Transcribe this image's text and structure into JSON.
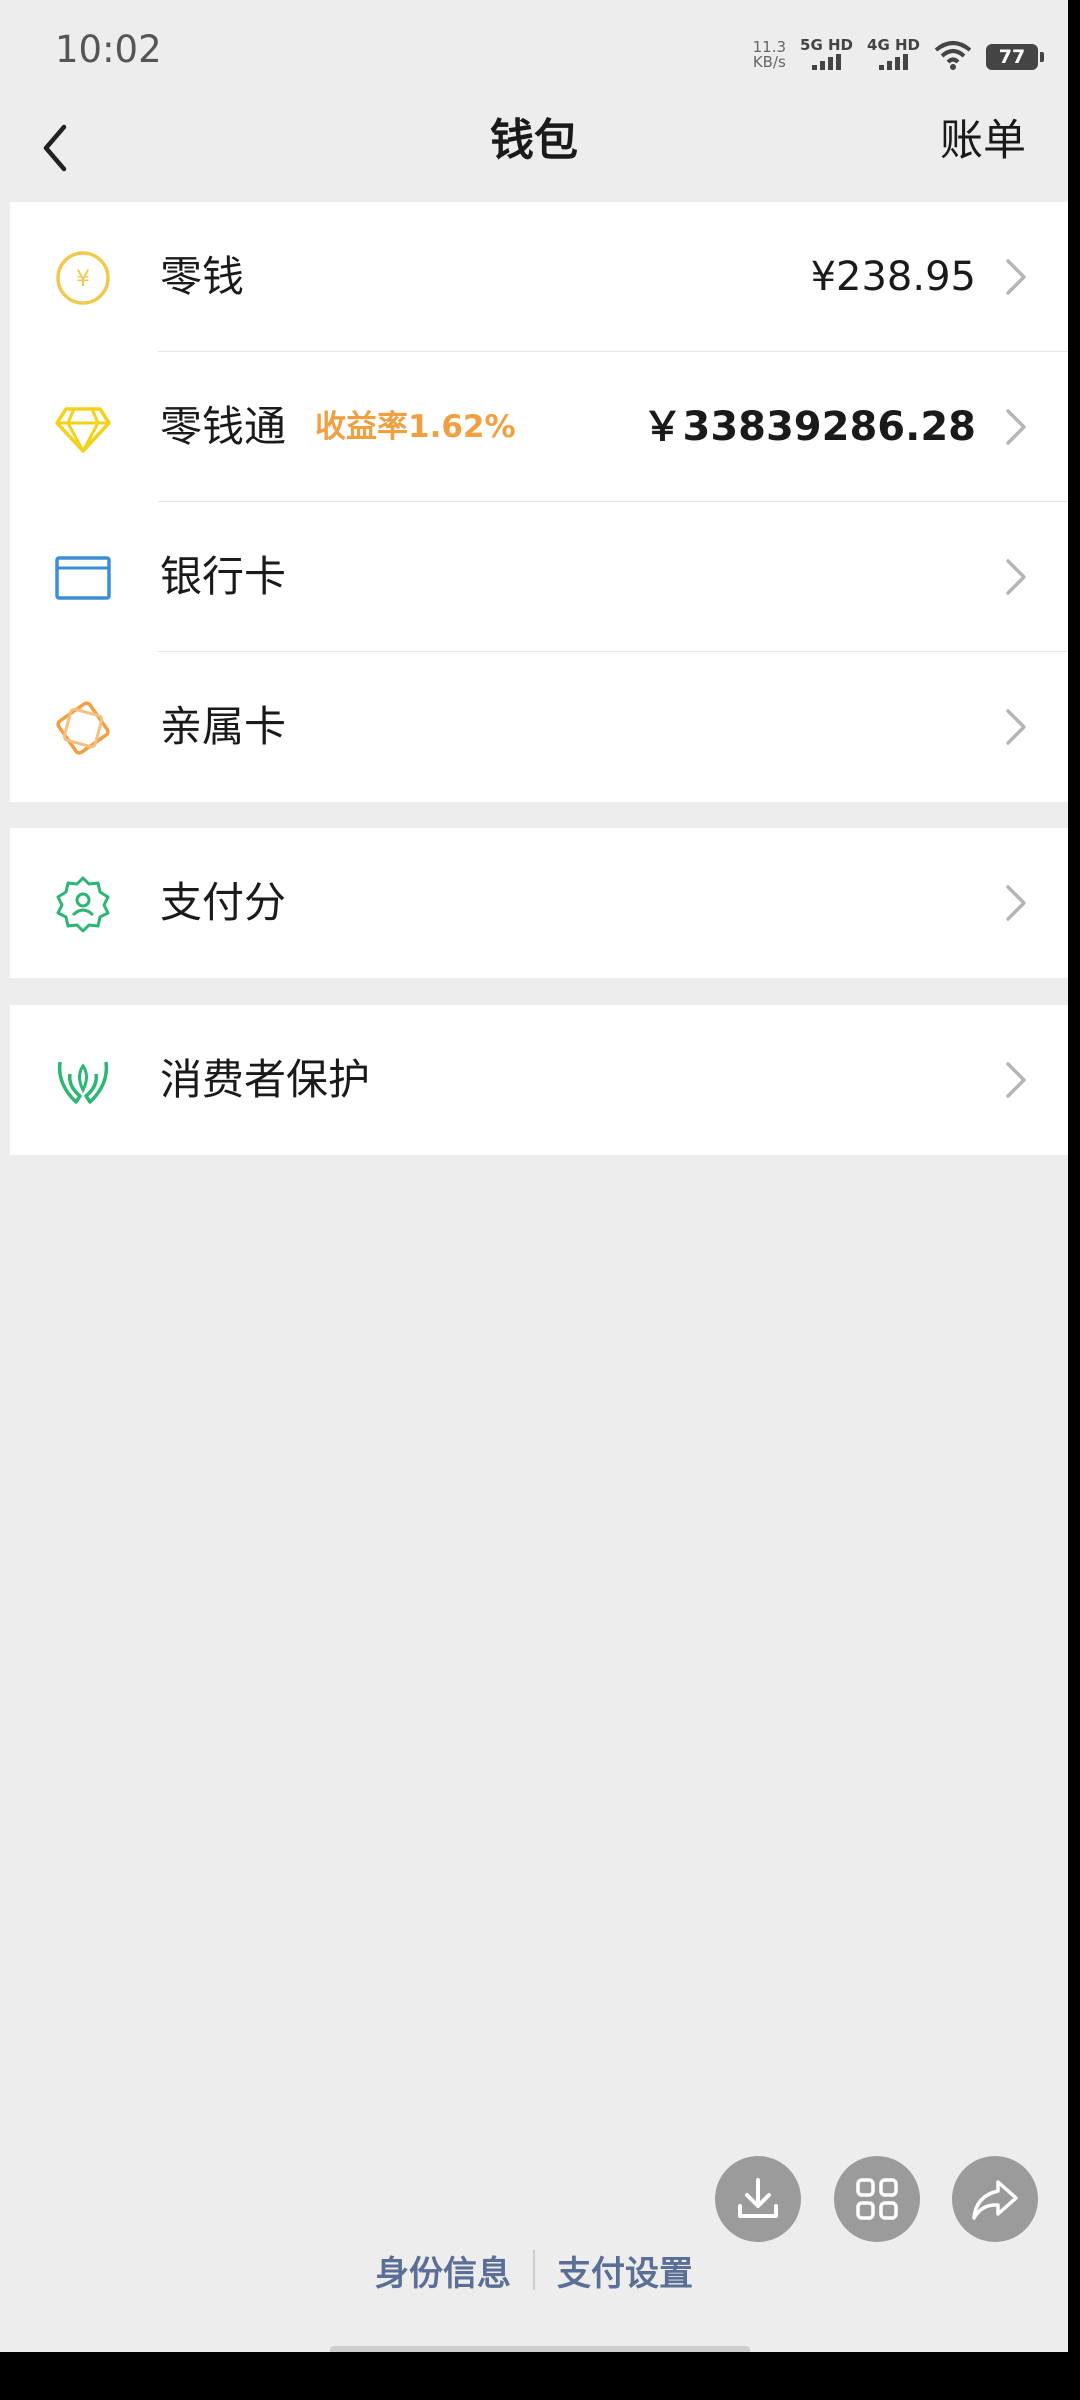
{
  "status_bar": {
    "time": "10:02",
    "net_speed_value": "11.3",
    "net_speed_unit": "KB/s",
    "sim1_label": "5G HD",
    "sim2_label": "4G HD",
    "battery": "77"
  },
  "header": {
    "title": "钱包",
    "bill_label": "账单"
  },
  "groups": [
    [
      {
        "label": "零钱",
        "value": "¥238.95",
        "icon": "coin-yuan-icon",
        "color": "#f2c94c"
      },
      {
        "label": "零钱通",
        "badge": "收益率1.62%",
        "value": "￥33839286.28",
        "icon": "diamond-icon",
        "color": "#f2d21b"
      },
      {
        "label": "银行卡",
        "icon": "bank-card-icon",
        "color": "#3a8fd6"
      },
      {
        "label": "亲属卡",
        "icon": "family-card-icon",
        "color": "#f0a040"
      }
    ],
    [
      {
        "label": "支付分",
        "icon": "pay-score-icon",
        "color": "#2bb673"
      }
    ],
    [
      {
        "label": "消费者保护",
        "icon": "consumer-protection-icon",
        "color": "#2bb673"
      }
    ]
  ],
  "footer": {
    "identity_label": "身份信息",
    "pay_settings_label": "支付设置"
  },
  "floating_actions": [
    "download-icon",
    "grid-icon",
    "share-icon"
  ]
}
